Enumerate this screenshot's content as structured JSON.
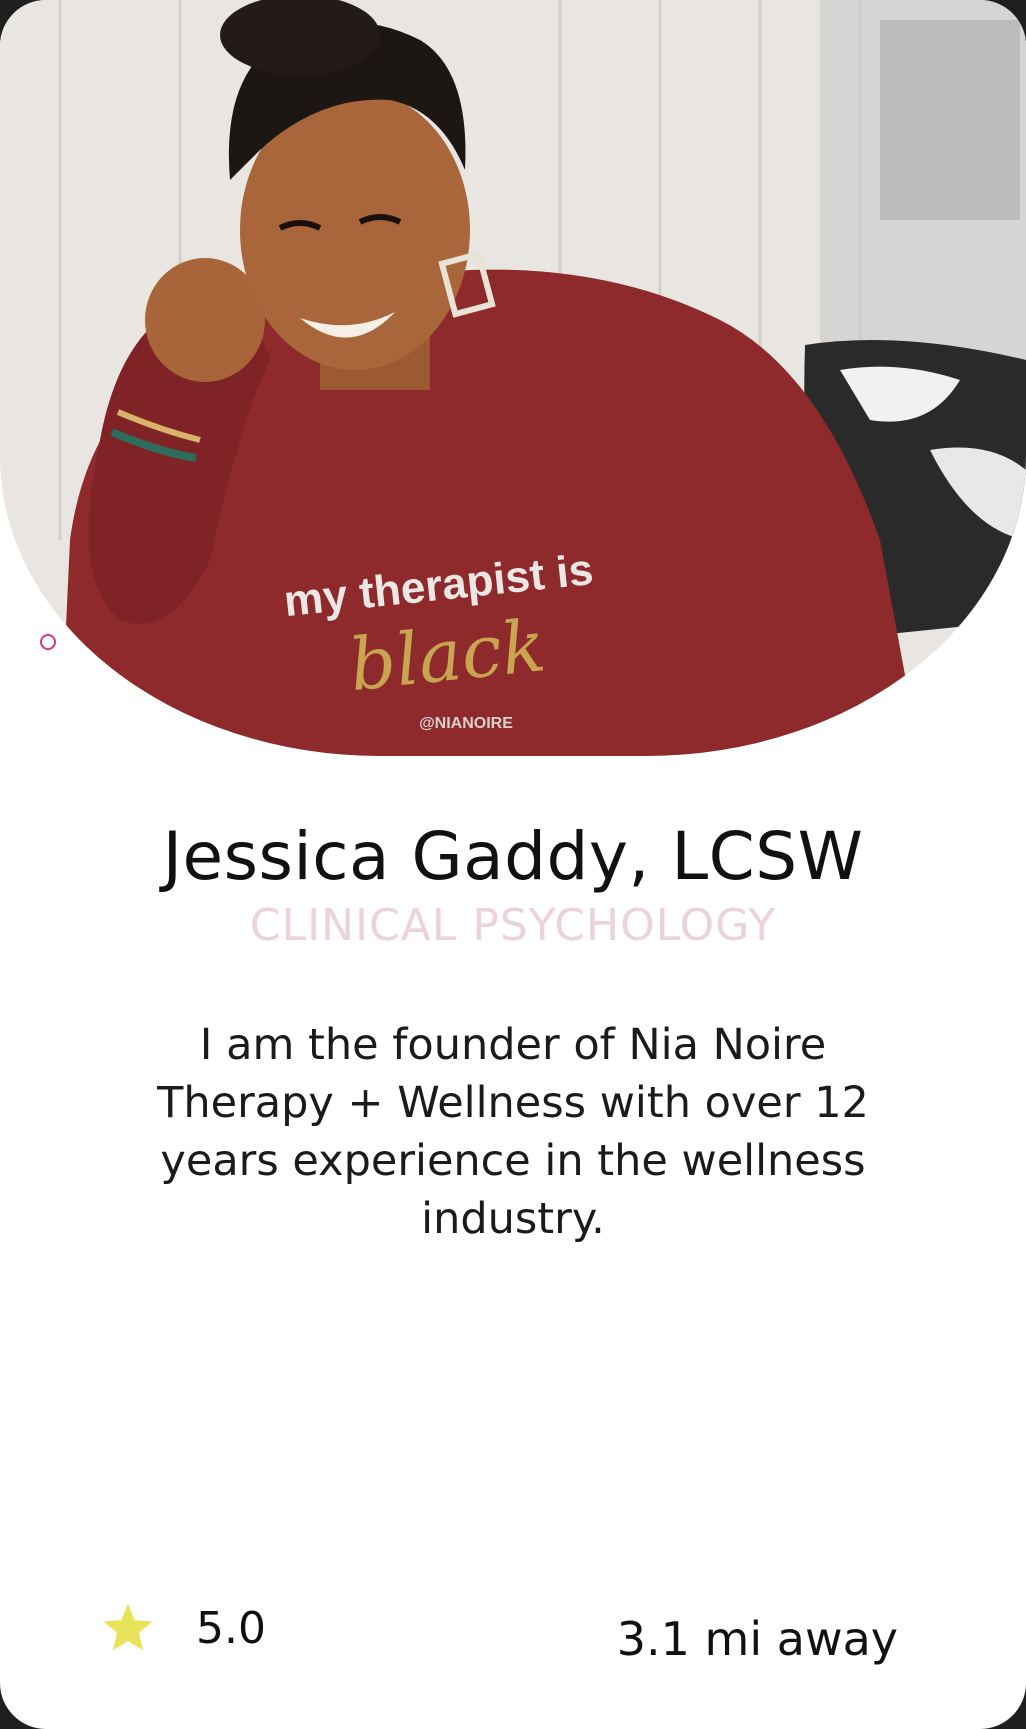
{
  "profile": {
    "photo": {
      "shirt_line1": "my therapist is",
      "shirt_line2": "black",
      "shirt_brand": "@NIANOIRE"
    },
    "name": "Jessica Gaddy, LCSW",
    "specialty": "CLINICAL PSYCHOLOGY",
    "bio": "I am the founder of Nia Noire Therapy + Wellness with over 12 years experience in the wellness industry.",
    "rating": "5.0",
    "distance": "3.1 mi away"
  },
  "colors": {
    "accent_pink": "#d2358b",
    "specialty_text": "#ecd3d8",
    "star": "#e8e35a",
    "shirt": "#8e2a2b"
  },
  "icons": {
    "rating": "star-icon"
  }
}
